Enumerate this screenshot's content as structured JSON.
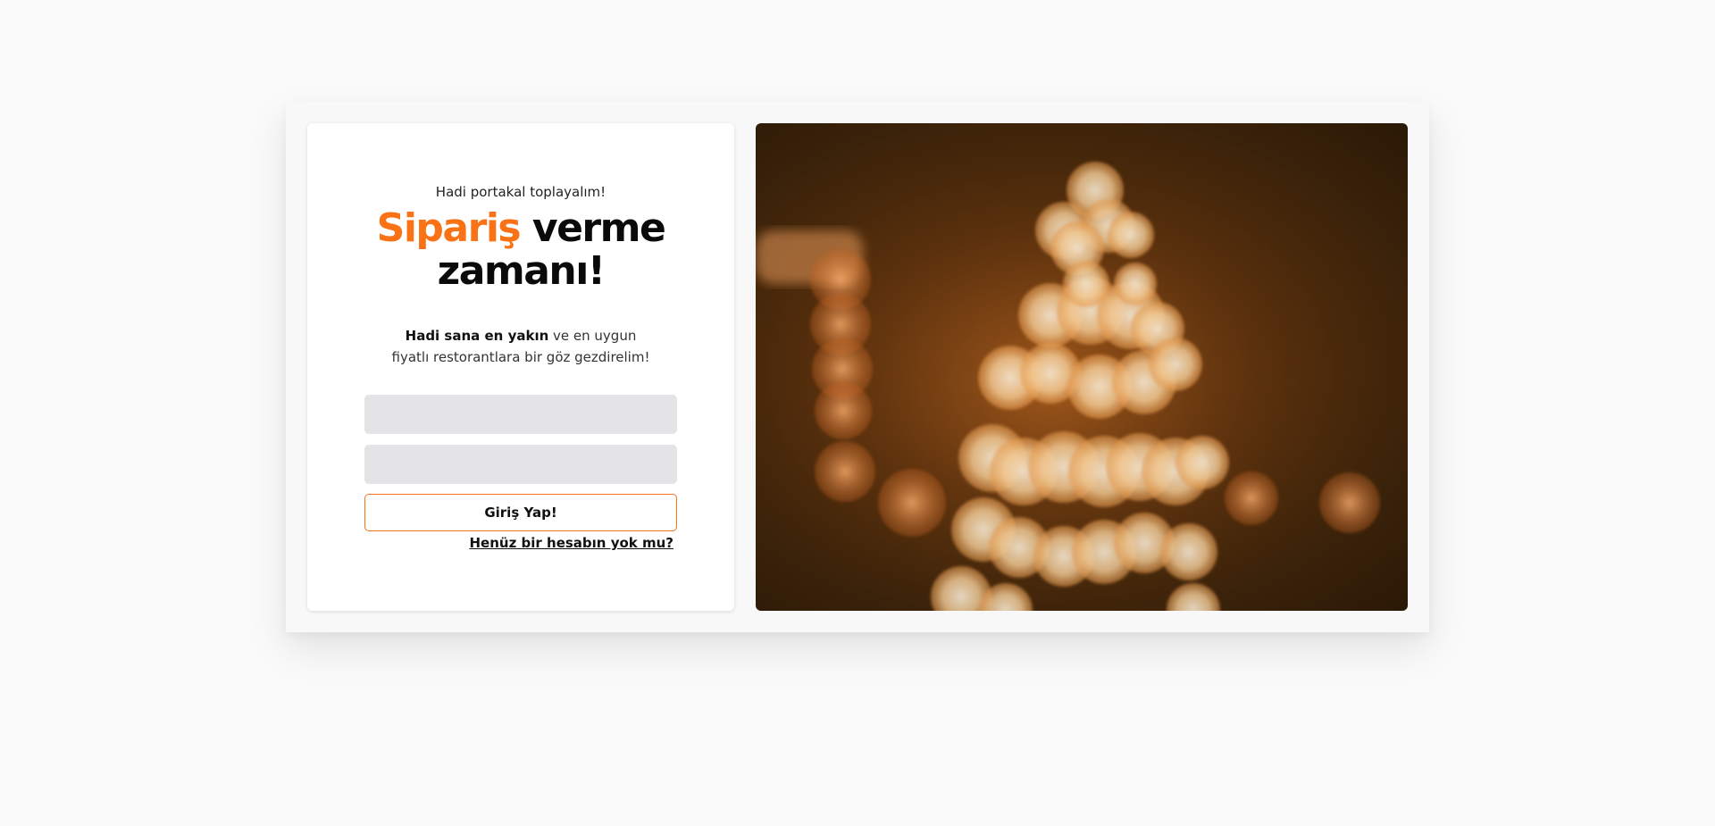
{
  "login": {
    "tagline": "Hadi portakal toplayalım!",
    "heading_accent": "Sipariş",
    "heading_rest": " verme zamanı!",
    "description_bold": "Hadi sana en yakın",
    "description_rest": " ve en uygun fiyatlı restorantlara bir göz gezdirelim!",
    "email_value": "",
    "email_placeholder": "",
    "password_value": "",
    "password_placeholder": "",
    "login_button_label": "Giriş Yap!",
    "signup_link_label": "Henüz bir hesabın yok mu?"
  },
  "colors": {
    "accent": "#f97316",
    "input_bg": "#e4e4e7",
    "page_bg": "#fafafa"
  },
  "hero_image": {
    "description": "bokeh-christmas-tree-icon"
  }
}
